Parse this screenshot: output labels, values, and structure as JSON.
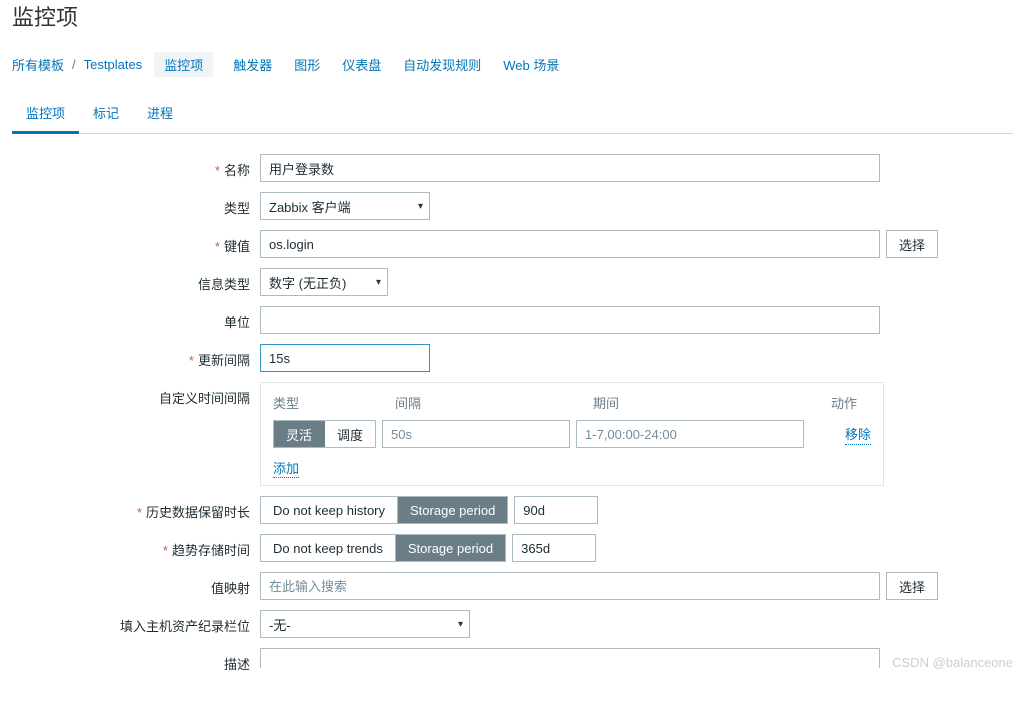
{
  "header": {
    "title": "监控项"
  },
  "breadcrumb": {
    "root": "所有模板",
    "sep": "/",
    "template": "Testplates",
    "current": "监控项",
    "links": [
      "触发器",
      "图形",
      "仪表盘",
      "自动发现规则",
      "Web 场景"
    ]
  },
  "tabs": {
    "items": [
      "监控项",
      "标记",
      "进程"
    ],
    "active_index": 0
  },
  "form": {
    "name": {
      "label": "名称",
      "value": "用户登录数"
    },
    "type": {
      "label": "类型",
      "value": "Zabbix 客户端"
    },
    "key": {
      "label": "键值",
      "value": "os.login",
      "select_btn": "选择"
    },
    "info_type": {
      "label": "信息类型",
      "value": "数字 (无正负)"
    },
    "units": {
      "label": "单位",
      "value": ""
    },
    "update_interval": {
      "label": "更新间隔",
      "value": "15s"
    },
    "custom": {
      "label": "自定义时间间隔",
      "head": {
        "type": "类型",
        "interval": "间隔",
        "period": "期间",
        "action": "动作"
      },
      "seg": {
        "flexible": "灵活",
        "schedule": "调度"
      },
      "interval_placeholder": "50s",
      "period_placeholder": "1-7,00:00-24:00",
      "remove": "移除",
      "add": "添加"
    },
    "history": {
      "label": "历史数据保留时长",
      "opt1": "Do not keep history",
      "opt2": "Storage period",
      "value": "90d"
    },
    "trends": {
      "label": "趋势存储时间",
      "opt1": "Do not keep trends",
      "opt2": "Storage period",
      "value": "365d"
    },
    "valuemap": {
      "label": "值映射",
      "placeholder": "在此输入搜索",
      "select_btn": "选择"
    },
    "inventory": {
      "label": "填入主机资产纪录栏位",
      "value": "-无-"
    },
    "description": {
      "label": "描述"
    }
  },
  "watermark": "CSDN @balanceone"
}
